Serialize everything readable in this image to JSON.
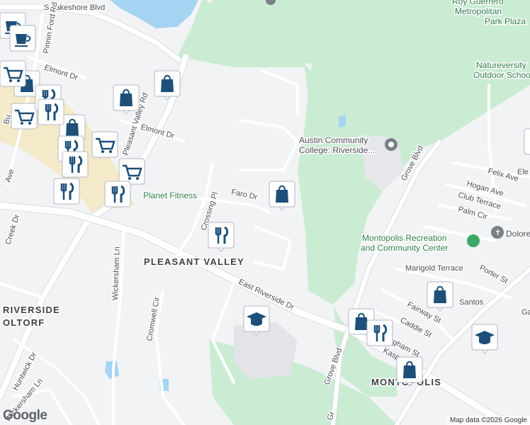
{
  "map": {
    "streets": {
      "s_lakeshore": "S Lakeshore Blvd",
      "pinnin_ford": "Pinnin Ford Rd",
      "elmont_dr_upper": "Elmont Dr",
      "elmont_dr": "Elmont Dr",
      "pleasant_valley": "Pleasant Valley Rd",
      "faro": "Faro Dr",
      "crossing": "Crossing Pl",
      "wickersham": "Wickersham Ln",
      "east_riverside": "East Riverside Dr",
      "cromwell": "Cromwell Cir",
      "grove_blvd_upper": "Grove Blvd",
      "grove_blvd_lower": "Grove Blvd",
      "felix": "Felix Ave",
      "hogan": "Hogan Ave",
      "club_terrace": "Club Terrace",
      "palm_cir": "Palm Cir",
      "marigold": "Marigold Terrace",
      "porter": "Porter St",
      "fairway": "Fairway St",
      "caddie": "Caddie St",
      "creek_dr": "Creek Dr",
      "huntwick": "Huntwick Dr",
      "wickersham_lower": "Wickersham Ln",
      "ave_left": "Ave",
      "santos": "Santos",
      "kasp": "Kasp",
      "ngham": "ngham St",
      "ga": "Ga",
      "ele": "Ele",
      "gr": "Gr",
      "bu": "Bu"
    },
    "areas": {
      "pleasant_valley": "PLEASANT VALLEY",
      "riverside": "RIVERSIDE",
      "oltorf": "OLTORF",
      "montopolis": "MONTOPOLIS"
    },
    "pois": {
      "acc_line1": "Austin Community",
      "acc_line2": "College: Riverside...",
      "planet_fitness": "Planet Fitness",
      "roy_line1": "Roy Guerrero",
      "roy_line2": "Metropolitan",
      "roy_line3": "Park Plaza",
      "nature_line1": "Natureversity",
      "nature_line2": "Outdoor School",
      "montopolis_line1": "Montopolis Recreation",
      "montopolis_line2": "and Community Center",
      "dolores": "Dolores"
    },
    "attribution": "Map data ©2026 Google",
    "logo": "Google",
    "colors": {
      "park": "#c9ecd2",
      "water": "#a5d4f3",
      "pin": "#1d4f79",
      "commercial": "#f4e9c8"
    }
  }
}
